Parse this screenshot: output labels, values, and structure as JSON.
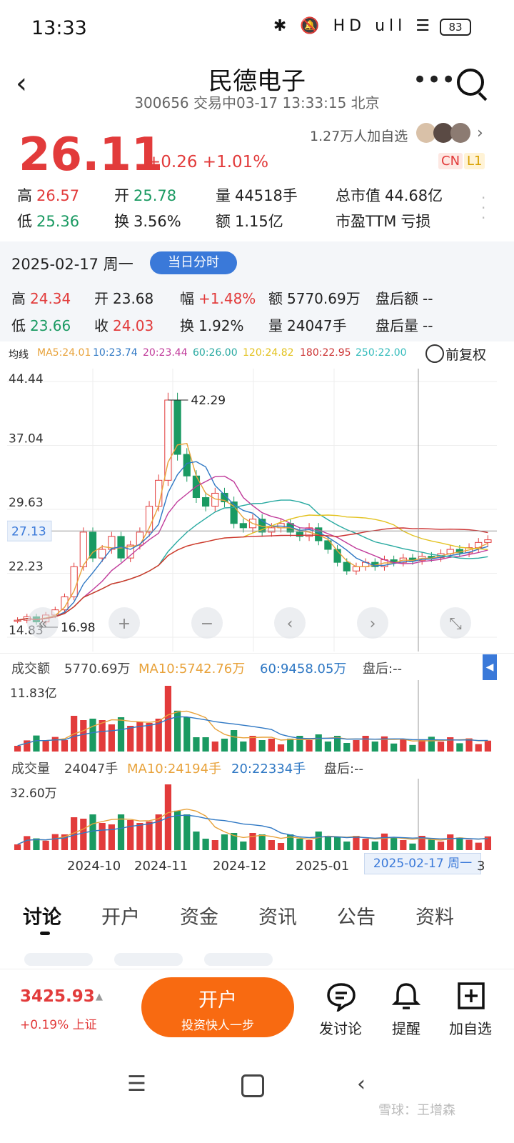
{
  "status": {
    "time": "13:33",
    "battery": "83",
    "icons": "✱ 🔕 HD ull ☰"
  },
  "header": {
    "title": "民德电子",
    "subtitle": "300656 交易中03-17 13:33:15 北京"
  },
  "quote": {
    "price": "26.11",
    "change": "+0.26 +1.01%",
    "followers": "1.27万人加自选",
    "tag_cn": "CN",
    "tag_l1": "L1",
    "rows": [
      [
        {
          "k": "高",
          "v": "26.57",
          "c": "red"
        },
        {
          "k": "开",
          "v": "25.78",
          "c": "green"
        },
        {
          "k": "量",
          "v": "44518手",
          "c": ""
        },
        {
          "k": "总市值",
          "v": "44.68亿",
          "c": ""
        }
      ],
      [
        {
          "k": "低",
          "v": "25.36",
          "c": "green"
        },
        {
          "k": "换",
          "v": "3.56%",
          "c": ""
        },
        {
          "k": "额",
          "v": "1.15亿",
          "c": ""
        },
        {
          "k": "市盈TTM",
          "v": "亏损",
          "c": ""
        }
      ]
    ]
  },
  "day": {
    "date": "2025-02-17 周一",
    "pill": "当日分时",
    "rows": [
      [
        {
          "k": "高",
          "v": "24.34",
          "c": "red"
        },
        {
          "k": "开",
          "v": "23.68",
          "c": ""
        },
        {
          "k": "幅",
          "v": "+1.48%",
          "c": "red"
        },
        {
          "k": "额",
          "v": "5770.69万",
          "c": ""
        },
        {
          "k": "盘后额",
          "v": "--",
          "c": ""
        }
      ],
      [
        {
          "k": "低",
          "v": "23.66",
          "c": "green"
        },
        {
          "k": "收",
          "v": "24.03",
          "c": "red"
        },
        {
          "k": "换",
          "v": "1.92%",
          "c": ""
        },
        {
          "k": "量",
          "v": "24047手",
          "c": ""
        },
        {
          "k": "盘后量",
          "v": "--",
          "c": ""
        }
      ]
    ]
  },
  "ma": {
    "label": "均线",
    "items": [
      {
        "t": "MA5:24.01",
        "color": "#e8a23a"
      },
      {
        "t": "10:23.74",
        "color": "#2f78c4"
      },
      {
        "t": "20:23.44",
        "color": "#c03a9a"
      },
      {
        "t": "60:26.00",
        "color": "#27a9a0"
      },
      {
        "t": "120:24.82",
        "color": "#e3c21f"
      },
      {
        "t": "180:22.95",
        "color": "#c33"
      },
      {
        "t": "250:22.00",
        "color": "#33bbbb"
      }
    ],
    "restore": "前复权"
  },
  "chart_data": {
    "type": "candlestick",
    "y_ticks": [
      "44.44",
      "37.04",
      "29.63",
      "22.23",
      "14.83"
    ],
    "ylim": [
      14.83,
      44.44
    ],
    "crosshair_value": "27.13",
    "high_mark": "42.29",
    "low_mark": "16.98",
    "x_labels": [
      "2024-10",
      "2024-11",
      "2024-12",
      "2025-01",
      "3"
    ],
    "selected_date": "2025-02-17 周一",
    "closes_approx": [
      16.8,
      17.2,
      16.6,
      17.4,
      18.0,
      19.5,
      23.0,
      27.0,
      24.0,
      25.0,
      26.5,
      24.0,
      25.5,
      27.0,
      30.0,
      33.0,
      42.29,
      36.0,
      33.5,
      31.0,
      30.0,
      31.5,
      30.5,
      28.0,
      27.5,
      28.5,
      27.0,
      27.5,
      28.0,
      27.0,
      26.5,
      27.5,
      26.0,
      25.0,
      23.5,
      22.5,
      23.0,
      23.5,
      23.0,
      23.8,
      23.5,
      24.0,
      23.7,
      24.2,
      24.03,
      24.5,
      25.0,
      24.6,
      25.2,
      25.8,
      26.11
    ]
  },
  "turnover": {
    "label": "成交额",
    "value": "5770.69万",
    "ma10": "MA10:5742.76万",
    "ma60": "60:9458.05万",
    "after": "盘后:--",
    "max": "11.83亿"
  },
  "volume": {
    "label": "成交量",
    "value": "24047手",
    "ma10": "MA10:24194手",
    "ma20": "20:22334手",
    "after": "盘后:--",
    "max": "32.60万"
  },
  "tabs": [
    "讨论",
    "开户",
    "资金",
    "资讯",
    "公告",
    "资料"
  ],
  "bottom": {
    "index_value": "3425.93",
    "index_change": "+0.19% 上证",
    "open_title": "开户",
    "open_sub": "投资快人一步",
    "actions": [
      "发讨论",
      "提醒",
      "加自选"
    ]
  },
  "watermark": "雪球：王增森"
}
